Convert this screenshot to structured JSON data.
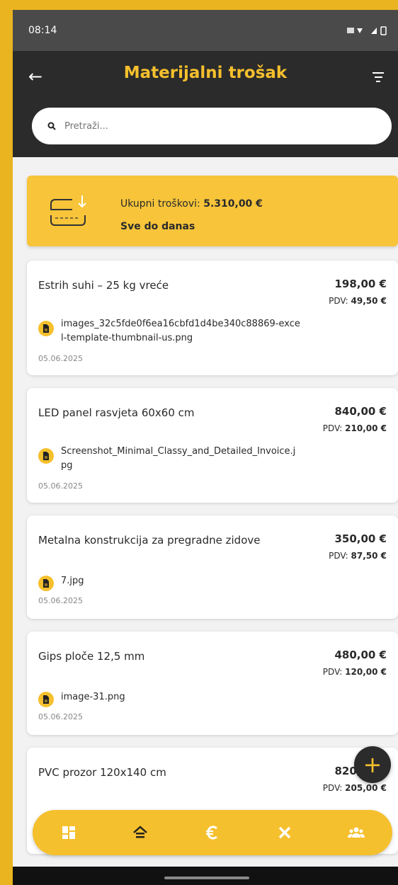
{
  "status": {
    "time": "08:14"
  },
  "header": {
    "title": "Materijalni trošak"
  },
  "search": {
    "placeholder": "Pretraži..."
  },
  "summary": {
    "label": "Ukupni troškovi: ",
    "total": "5.310,00 €",
    "period": "Sve do danas"
  },
  "vat_label": "PDV: ",
  "expenses": [
    {
      "name": "Estrih suhi – 25 kg vreće",
      "price": "198,00 €",
      "vat": "49,50 €",
      "file": "images_32c5fde0f6ea16cbfd1d4be340c88869-excel-template-thumbnail-us.png",
      "date": "05.06.2025"
    },
    {
      "name": "LED panel rasvjeta 60x60 cm",
      "price": "840,00 €",
      "vat": "210,00 €",
      "file": "Screenshot_Minimal_Classy_and_Detailed_Invoice.jpg",
      "date": "05.06.2025"
    },
    {
      "name": "Metalna konstrukcija za pregradne zidove",
      "price": "350,00 €",
      "vat": "87,50 €",
      "file": "7.jpg",
      "date": "05.06.2025"
    },
    {
      "name": "Gips ploče 12,5 mm",
      "price": "480,00 €",
      "vat": "120,00 €",
      "file": "image-31.png",
      "date": "05.06.2025"
    },
    {
      "name": "PVC prozor 120x140 cm",
      "price": "820,00 €",
      "vat": "205,00 €",
      "file": "",
      "date": ""
    }
  ],
  "fab": {
    "label": "+"
  },
  "nav": [
    {
      "icon": "dashboard-icon"
    },
    {
      "icon": "home-icon"
    },
    {
      "icon": "euro-icon"
    },
    {
      "icon": "tools-icon"
    },
    {
      "icon": "people-icon"
    }
  ]
}
